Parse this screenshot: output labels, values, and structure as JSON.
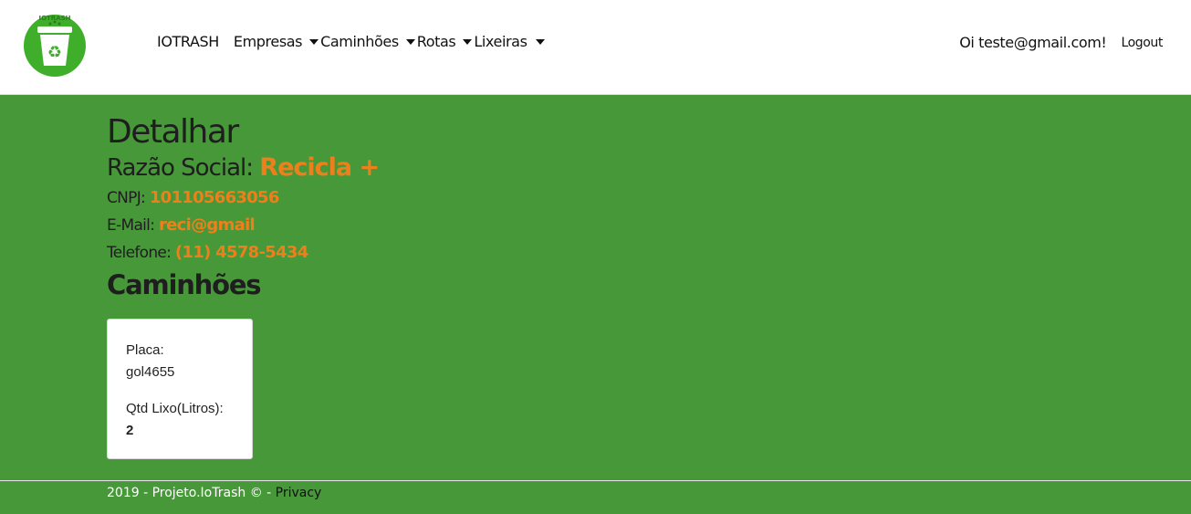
{
  "nav": {
    "brand": "IOTRASH",
    "logo_text": "IOTRASH",
    "menus": [
      "Empresas",
      "Caminhões",
      "Rotas",
      "Lixeiras"
    ],
    "greeting": "Oi teste@gmail.com!",
    "logout": "Logout"
  },
  "page": {
    "title": "Detalhar",
    "razao_label": "Razão Social:",
    "razao_value": "Recicla +",
    "cnpj_label": "CNPJ:",
    "cnpj_value": "101105663056",
    "email_label": "E-Mail:",
    "email_value": "reci@gmail",
    "telefone_label": "Telefone:",
    "telefone_value": "(11) 4578-5434",
    "section_title": "Caminhões"
  },
  "card": {
    "placa_label": "Placa:",
    "placa_value": "gol4655",
    "qtd_label": "Qtd Lixo(Litros):",
    "qtd_value": "2"
  },
  "footer": {
    "text": "2019 - Projeto.IoTrash © - ",
    "privacy": "Privacy"
  },
  "colors": {
    "background": "#479839",
    "accent": "#ee7f1b",
    "logo_green": "#3fae2a"
  }
}
